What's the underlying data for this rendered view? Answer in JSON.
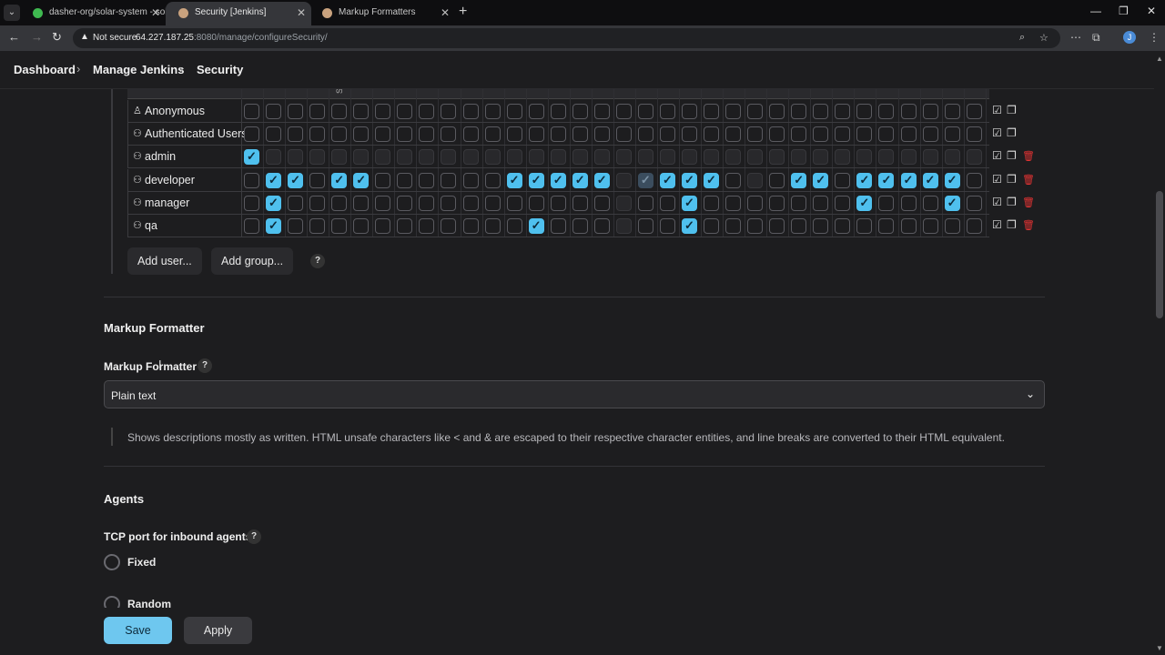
{
  "browser": {
    "tabs": [
      {
        "title": "dasher-org/solar-system - sola",
        "active": false,
        "favicon_color": "#3fb950"
      },
      {
        "title": "Security [Jenkins]",
        "active": true,
        "favicon_color": "#c9a27e"
      },
      {
        "title": "Markup Formatters",
        "active": false,
        "favicon_color": "#c9a27e"
      }
    ],
    "not_secure_label": "Not secure",
    "url_host": "64.227.187.25",
    "url_rest": ":8080/manage/configureSecurity/",
    "profile_initial": "J"
  },
  "breadcrumb": {
    "items": [
      "Dashboard",
      "Manage Jenkins",
      "Security"
    ]
  },
  "matrix": {
    "header_fragment": "S",
    "rows": [
      {
        "name": "Anonymous",
        "icon": "user-icon",
        "cells": "0000000000000000000000000000000000",
        "disabled": "",
        "deletable": false
      },
      {
        "name": "Authenticated Users",
        "icon": "group-icon",
        "cells": "0000000000000000000000000000000000",
        "disabled": "",
        "deletable": false
      },
      {
        "name": "admin",
        "icon": "group-icon",
        "cells": "1000000000000000000000000000000000",
        "disabled": "0111111111111111111111111111111111",
        "deletable": true
      },
      {
        "name": "developer",
        "icon": "group-icon",
        "cells": "0110110000001111102111000110111110",
        "disabled": "0000000000000000010000010000000000",
        "deletable": true
      },
      {
        "name": "manager",
        "icon": "group-icon",
        "cells": "0100000000000000000010000000100010",
        "disabled": "0000000000000000010000000000000000",
        "deletable": true
      },
      {
        "name": "qa",
        "icon": "group-icon",
        "cells": "0100000000000100000010000000000000",
        "disabled": "0000000000000000010000000000000000",
        "deletable": true
      }
    ],
    "add_user_label": "Add user...",
    "add_group_label": "Add group...",
    "help_label": "?"
  },
  "markup_formatter": {
    "section_title": "Markup Formatter",
    "field_label": "Markup Formatter",
    "help_label": "?",
    "selected": "Plain text",
    "description": "Shows descriptions mostly as written. HTML unsafe characters like < and & are escaped to their respective character entities, and line breaks are converted to their HTML equivalent."
  },
  "agents": {
    "section_title": "Agents",
    "field_label": "TCP port for inbound agents",
    "help_label": "?",
    "options": [
      "Fixed",
      "Random"
    ]
  },
  "actions": {
    "save_label": "Save",
    "apply_label": "Apply"
  },
  "colors": {
    "checked": "#4fc0ee",
    "save_button": "#6ec7ef",
    "delete": "#e33333"
  }
}
